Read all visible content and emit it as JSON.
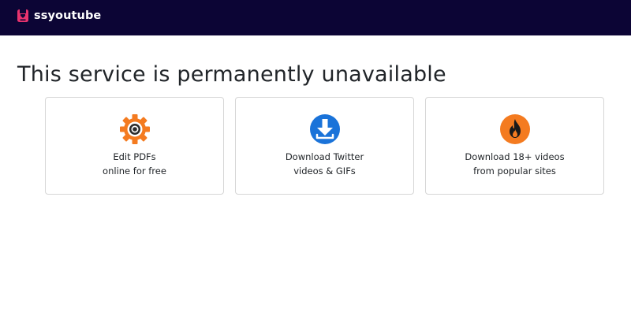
{
  "header": {
    "brand_name": "ssyoutube",
    "logo_icon": "ssyoutube-logo-icon",
    "background_color": "#0c0535",
    "logo_color": "#e8336e"
  },
  "main": {
    "title": "This service is permanently unavailable",
    "cards": [
      {
        "line1": "Edit PDFs",
        "line2": "online for free",
        "icon": "gear-icon",
        "icon_color": "#f47b20"
      },
      {
        "line1": "Download Twitter",
        "line2": "videos & GIFs",
        "icon": "download-icon",
        "icon_color": "#1a73d9"
      },
      {
        "line1": "Download 18+ videos",
        "line2": "from popular sites",
        "icon": "flame-icon",
        "icon_color": "#f47b20"
      }
    ]
  }
}
